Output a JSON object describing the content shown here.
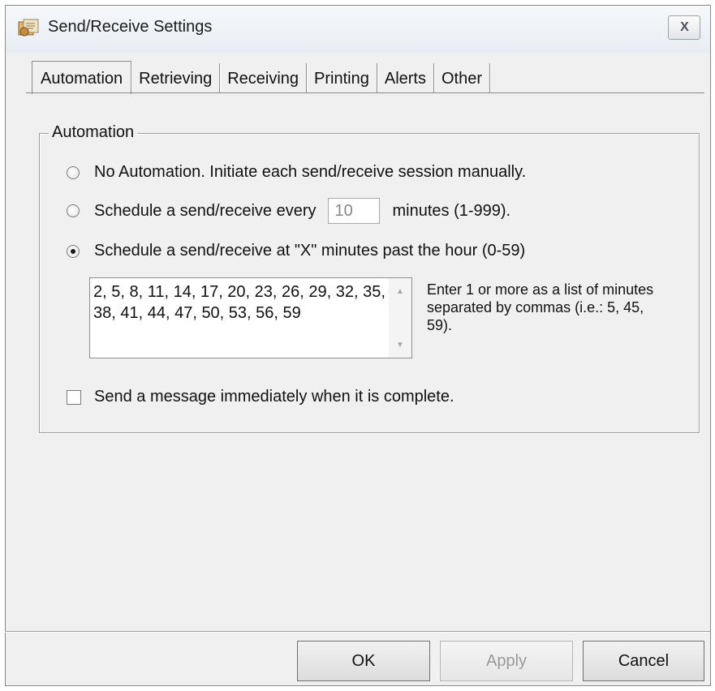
{
  "window": {
    "title": "Send/Receive Settings",
    "close_label": "X"
  },
  "tabs": [
    {
      "label": "Automation",
      "active": true
    },
    {
      "label": "Retrieving",
      "active": false
    },
    {
      "label": "Receiving",
      "active": false
    },
    {
      "label": "Printing",
      "active": false
    },
    {
      "label": "Alerts",
      "active": false
    },
    {
      "label": "Other",
      "active": false
    }
  ],
  "automation": {
    "group_title": "Automation",
    "option_none": "No Automation.  Initiate each send/receive session manually.",
    "option_every_before": "Schedule a send/receive every",
    "option_every_value": "10",
    "option_every_after": "minutes (1-999).",
    "option_past_hour": "Schedule a send/receive at \"X\" minutes past the hour (0-59)",
    "selected_option": "past_hour",
    "minutes_list": "2, 5, 8, 11, 14, 17, 20, 23, 26, 29, 32, 35, 38, 41, 44, 47, 50, 53, 56, 59",
    "minutes_hint": "Enter 1 or more as a list of minutes separated by commas (i.e.: 5, 45, 59).",
    "send_immediately_label": "Send a message immediately when it is complete.",
    "send_immediately_checked": false
  },
  "buttons": {
    "ok": "OK",
    "apply": "Apply",
    "cancel": "Cancel"
  }
}
